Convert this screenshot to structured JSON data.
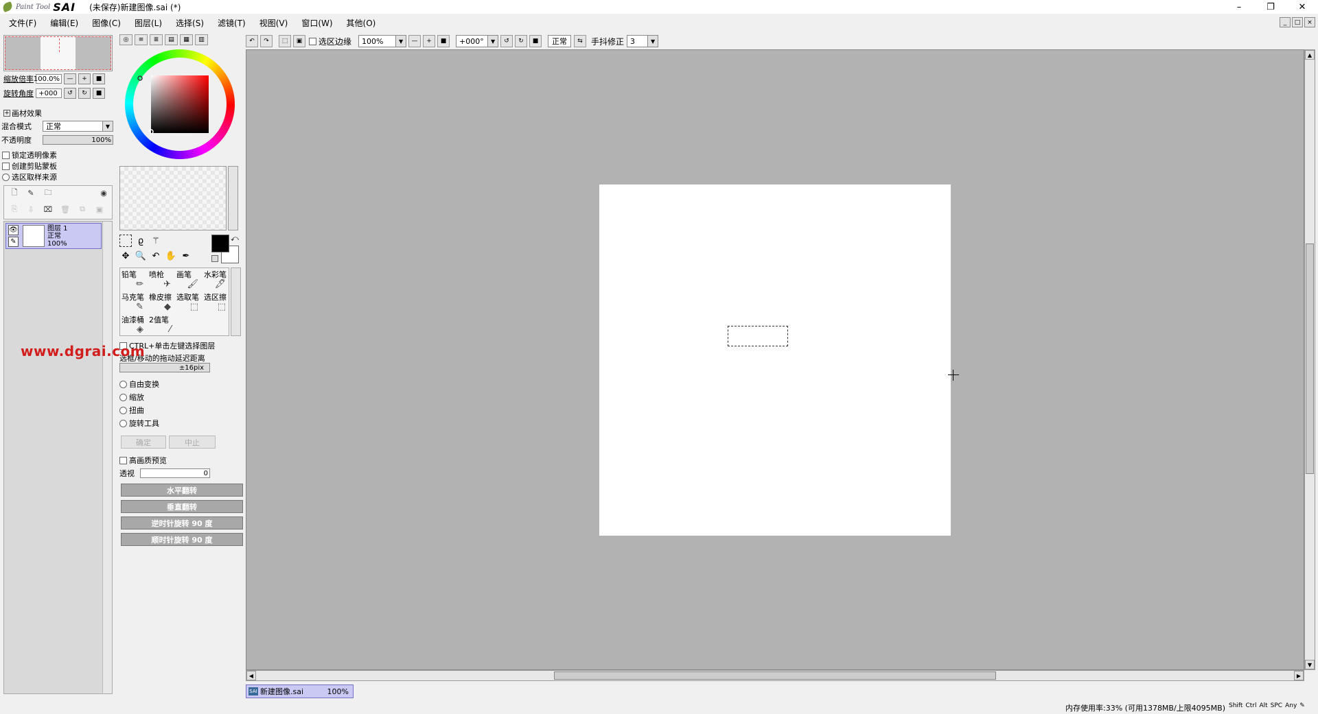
{
  "titlebar": {
    "brand_small": "Paint Tool",
    "brand_large": "SAI",
    "document_title": "(未保存)新建图像.sai (*)",
    "minimize": "–",
    "restore": "❐",
    "close": "✕"
  },
  "menu": [
    "文件(F)",
    "编辑(E)",
    "图像(C)",
    "图层(L)",
    "选择(S)",
    "滤镜(T)",
    "视图(V)",
    "窗口(W)",
    "其他(O)"
  ],
  "navigator": {
    "zoom_label": "缩放倍率",
    "zoom_value": "100.0%",
    "rotate_label": "旋转角度",
    "rotate_value": "+000"
  },
  "layer_props": {
    "effects_label": "画材效果",
    "blend_label": "混合模式",
    "blend_value": "正常",
    "opacity_label": "不透明度",
    "opacity_value": "100%",
    "lock_transparency": "锁定透明像素",
    "clipping_mask": "创建剪贴蒙板",
    "selection_source": "选区取样来源"
  },
  "layers": [
    {
      "name": "图层 1",
      "mode": "正常",
      "opacity": "100%"
    }
  ],
  "toolbar": {
    "selection_edge_label": "选区边缘",
    "zoom_value": "100%",
    "angle_value": "+000°",
    "blend_value": "正常",
    "stabilizer_label": "手抖修正",
    "stabilizer_value": "3"
  },
  "brushes": [
    {
      "label": "铅笔",
      "icon": "pencil-icon"
    },
    {
      "label": "喷枪",
      "icon": "airbrush-icon"
    },
    {
      "label": "画笔",
      "icon": "brush-icon"
    },
    {
      "label": "水彩笔",
      "icon": "watercolor-icon"
    },
    {
      "label": "马克笔",
      "icon": "marker-icon"
    },
    {
      "label": "橡皮擦",
      "icon": "eraser-icon"
    },
    {
      "label": "选取笔",
      "icon": "select-pen-icon"
    },
    {
      "label": "选区擦",
      "icon": "select-eraser-icon"
    },
    {
      "label": "油漆桶",
      "icon": "bucket-icon"
    },
    {
      "label": "2值笔",
      "icon": "binary-pen-icon"
    }
  ],
  "tool_options": {
    "ctrl_click_label": "CTRL+单击左键选择图层",
    "drag_delay_label": "选框/移动的拖动延迟距离",
    "drag_delay_value": "±16pix",
    "free_transform": "自由变换",
    "scale": "缩放",
    "distort": "扭曲",
    "rotate_tool": "旋转工具",
    "ok_button": "确定",
    "cancel_button": "中止",
    "hq_preview": "高画质预览",
    "perspective_label": "透视",
    "perspective_value": "0",
    "flip_h": "水平翻转",
    "flip_v": "垂直翻转",
    "rotate_ccw": "逆时针旋转 90 度",
    "rotate_cw": "顺时针旋转 90 度"
  },
  "watermark": "www.dgrai.com",
  "document_tab": {
    "name": "新建图像.sai",
    "zoom": "100%",
    "icon_text": "SAI"
  },
  "status": {
    "memory": "内存使用率:33% (可用1378MB/上限4095MB)",
    "keys": [
      "Shift",
      "Ctrl",
      "Alt",
      "SPC",
      "Any"
    ]
  },
  "colors": {
    "canvas_bg": "#b2b2b2",
    "selected_layer": "#c9c9f4",
    "foreground": "#000000",
    "background": "#ffffff",
    "watermark": "#d21d1d"
  }
}
